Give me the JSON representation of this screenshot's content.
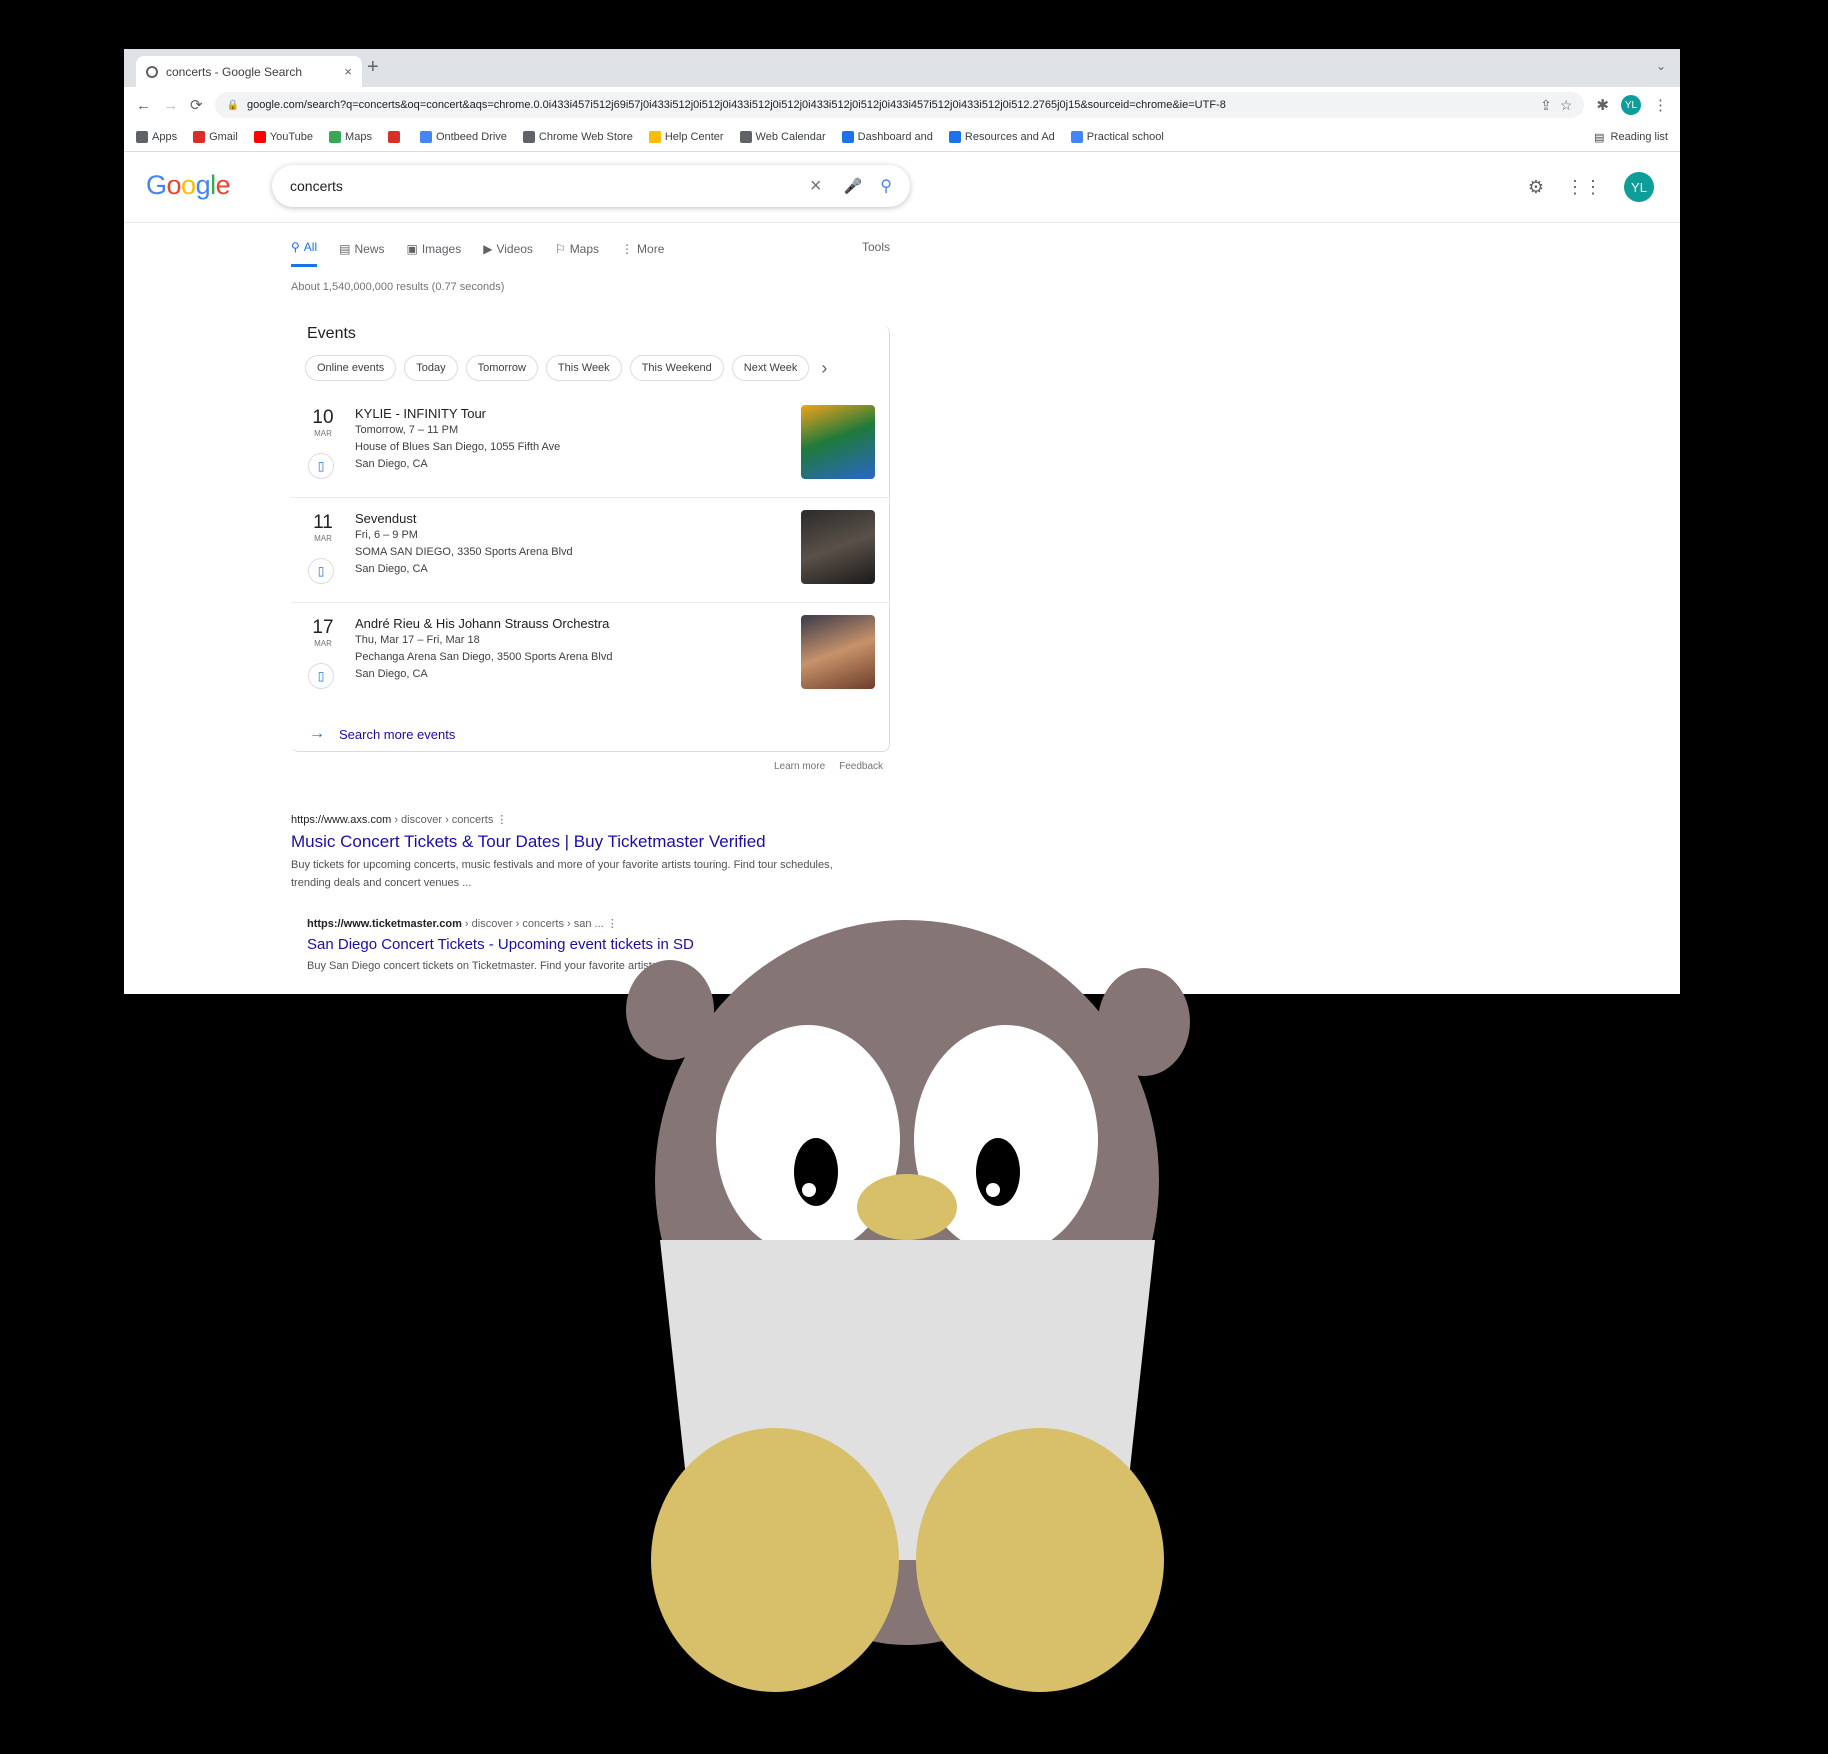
{
  "browser": {
    "tab_title": "concerts - Google Search",
    "tab_close": "×",
    "new_tab": "+",
    "tab_menu": "⌄",
    "url": "google.com/search?q=concerts&oq=concert&aqs=chrome.0.0i433i457i512j69i57j0i433i512j0i512j0i433i512j0i512j0i433i512j0i512j0i433i457i512j0i433i512j0i512.2765j0j15&sourceid=chrome&ie=UTF-8",
    "profile_initials": "YL",
    "bookmarks": [
      {
        "label": "Apps",
        "icon": "apps-icon",
        "color": "#5f6368"
      },
      {
        "label": "Gmail",
        "icon": "gmail-icon",
        "color": "#d93025"
      },
      {
        "label": "YouTube",
        "icon": "youtube-icon",
        "color": "#ff0000"
      },
      {
        "label": "Maps",
        "icon": "maps-icon",
        "color": "#34a853"
      },
      {
        "label": "",
        "icon": "bookmark-icon",
        "color": "#d93025"
      },
      {
        "label": "Ontbeed Drive",
        "icon": "drive-icon",
        "color": "#4285f4"
      },
      {
        "label": "Chrome Web Store",
        "icon": "music-icon",
        "color": "#5f6368"
      },
      {
        "label": "Help Center",
        "icon": "help-icon",
        "color": "#fbbc04"
      },
      {
        "label": "Web Calendar",
        "icon": "calendar-icon",
        "color": "#5f6368"
      },
      {
        "label": "Dashboard and",
        "icon": "dashboard-icon",
        "color": "#1a73e8"
      },
      {
        "label": "Resources and Ad",
        "icon": "resources-icon",
        "color": "#1a73e8"
      },
      {
        "label": "Practical school",
        "icon": "school-icon",
        "color": "#4285f4"
      }
    ],
    "reading_list": "Reading list"
  },
  "google": {
    "logo": "Google",
    "query": "concerts",
    "avatar_initials": "YL",
    "tabs": [
      {
        "label": "All",
        "icon": "search-icon",
        "active": true
      },
      {
        "label": "News",
        "icon": "news-icon",
        "active": false
      },
      {
        "label": "Images",
        "icon": "images-icon",
        "active": false
      },
      {
        "label": "Videos",
        "icon": "videos-icon",
        "active": false
      },
      {
        "label": "Maps",
        "icon": "maps-icon",
        "active": false
      },
      {
        "label": "More",
        "icon": "more-icon",
        "active": false
      }
    ],
    "tools": "Tools",
    "stats": "About 1,540,000,000 results (0.77 seconds)",
    "events": {
      "title": "Events",
      "chips": [
        "Online events",
        "Today",
        "Tomorrow",
        "This Week",
        "This Weekend",
        "Next Week"
      ],
      "items": [
        {
          "day": "10",
          "month": "Mar",
          "name": "KYLIE - INFINITY Tour",
          "time": "Tomorrow, 7 – 11 PM",
          "venue": "House of Blues San Diego, 1055 Fifth Ave",
          "city": "San Diego, CA"
        },
        {
          "day": "11",
          "month": "Mar",
          "name": "Sevendust",
          "time": "Fri, 6 – 9 PM",
          "venue": "SOMA SAN DIEGO, 3350 Sports Arena Blvd",
          "city": "San Diego, CA"
        },
        {
          "day": "17",
          "month": "Mar",
          "name": "André Rieu & His Johann Strauss Orchestra",
          "time": "Thu, Mar 17 – Fri, Mar 18",
          "venue": "Pechanga Arena San Diego, 3500 Sports Arena Blvd",
          "city": "San Diego, CA"
        }
      ],
      "more": "Search more events",
      "learn_more": "Learn more",
      "feedback": "Feedback"
    },
    "results": [
      {
        "url": "https://www.axs.com",
        "breadcrumb": "› discover › concerts",
        "title": "Music Concert Tickets & Tour Dates | Buy Ticketmaster Verified",
        "snippet": "Buy tickets for upcoming concerts, music festivals and more of your favorite artists touring. Find tour schedules, trending deals and concert venues ..."
      },
      {
        "url": "https://www.ticketmaster.com",
        "breadcrumb": "› discover › concerts › san ...",
        "title": "San Diego Concert Tickets - Upcoming event tickets in SD",
        "snippet": "Buy San Diego concert tickets on Ticketmaster. Find your favorite artists ..."
      }
    ]
  },
  "colors": {
    "link": "#1a0dab",
    "accent": "#1a73e8",
    "mascot_body": "#857574",
    "mascot_gold": "#d8c06a",
    "mascot_sign": "#e0e0e0"
  }
}
